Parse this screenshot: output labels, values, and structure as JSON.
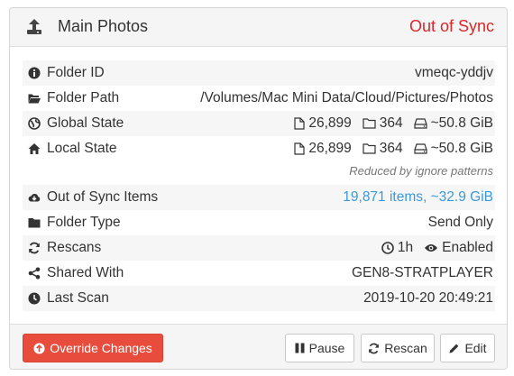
{
  "header": {
    "title": "Main Photos",
    "status": "Out of Sync",
    "status_color": "#d9282c"
  },
  "rows": {
    "folder_id": {
      "label": "Folder ID",
      "value": "vmeqc-yddjv"
    },
    "folder_path": {
      "label": "Folder Path",
      "value": "/Volumes/Mac Mini Data/Cloud/Pictures/Photos"
    },
    "global_state": {
      "label": "Global State",
      "files": "26,899",
      "dirs": "364",
      "size": "~50.8 GiB"
    },
    "local_state": {
      "label": "Local State",
      "files": "26,899",
      "dirs": "364",
      "size": "~50.8 GiB",
      "note": "Reduced by ignore patterns"
    },
    "out_of_sync": {
      "label": "Out of Sync Items",
      "value": "19,871 items, ~32.9 GiB",
      "color": "#3a9ad9"
    },
    "folder_type": {
      "label": "Folder Type",
      "value": "Send Only"
    },
    "rescans": {
      "label": "Rescans",
      "interval": "1h",
      "watch": "Enabled"
    },
    "shared_with": {
      "label": "Shared With",
      "value": "GEN8-STRATPLAYER"
    },
    "last_scan": {
      "label": "Last Scan",
      "value": "2019-10-20 20:49:21"
    }
  },
  "buttons": {
    "override": "Override Changes",
    "pause": "Pause",
    "rescan": "Rescan",
    "edit": "Edit"
  },
  "icons": [
    "upload-icon",
    "info-icon",
    "folder-open-icon",
    "globe-icon",
    "home-icon",
    "cloud-download-icon",
    "folder-icon",
    "refresh-icon",
    "share-icon",
    "clock-icon",
    "file-icon",
    "hdd-icon",
    "eye-icon",
    "pause-icon",
    "pencil-icon"
  ]
}
